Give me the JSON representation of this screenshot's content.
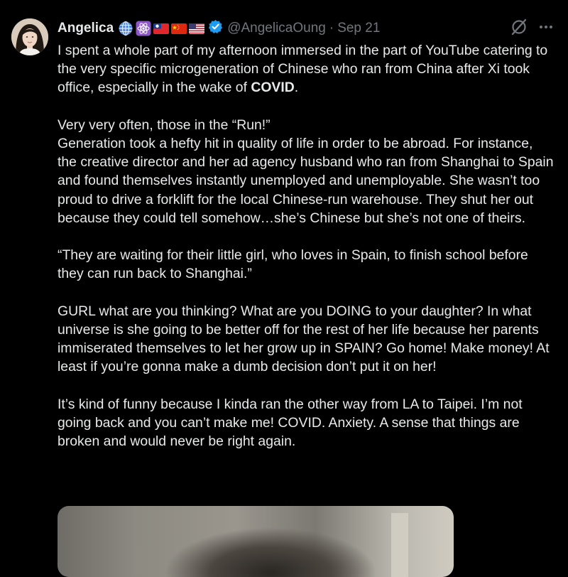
{
  "author": {
    "name": "Angelica",
    "handle": "@AngelicaOung",
    "separator": "·",
    "date": "Sep 21",
    "badges": [
      "globe-icon",
      "atom-icon",
      "taiwan-flag-icon",
      "china-flag-icon",
      "us-flag-icon"
    ],
    "verified_color": "#1d9bf0"
  },
  "actions": {
    "grok_icon": "grok-icon",
    "more_icon": "more-icon"
  },
  "tweet": {
    "intro": "I spent a whole part of my afternoon immersed in the part of YouTube catering to the very specific microgeneration of Chinese who ran from China after Xi took office, especially in the wake of ",
    "intro_bold": "COVID",
    "intro_end": ".",
    "p2": "Very very often, those in the “Run!”\nGeneration took a hefty hit in quality of life in order to be abroad. For instance, the creative director and her ad agency husband who ran from Shanghai to Spain and found themselves instantly unemployed and unemployable. She wasn’t too proud to drive a forklift for the local Chinese-run warehouse. They shut her out because they could tell somehow…she’s Chinese but she’s not one of theirs.",
    "p3": "“They are waiting for their little girl, who loves in Spain, to finish school before they can run back to Shanghai.”",
    "p4": "GURL what are you thinking? What are you DOING to your daughter? In what universe is she going to be better off for the rest of her life because her parents immiserated themselves to let her grow up in SPAIN? Go home! Make money! At least if you’re gonna make a dumb decision don’t put it on her!",
    "p5": "It’s kind of funny because I kinda ran the other way from LA to Taipei. I’m not going back and you can’t make me! COVID. Anxiety. A sense that things are broken and would never be right again."
  },
  "colors": {
    "background": "#000000",
    "text": "#e7e9ea",
    "secondary": "#71767b",
    "accent": "#1d9bf0"
  }
}
